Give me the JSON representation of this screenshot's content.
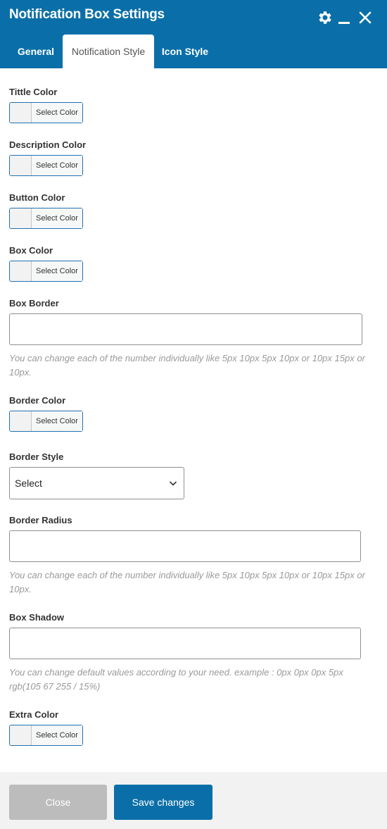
{
  "header": {
    "title": "Notification Box Settings",
    "icons": [
      "gear-icon",
      "minimize-icon",
      "close-icon"
    ],
    "accent_color": "#0a6fa8"
  },
  "tabs": [
    {
      "label": "General",
      "active": false
    },
    {
      "label": "Notification Style",
      "active": true
    },
    {
      "label": "Icon Style",
      "active": false
    }
  ],
  "form": {
    "title_color": {
      "label": "Tittle Color",
      "button": "Select Color"
    },
    "description_color": {
      "label": "Description Color",
      "button": "Select Color"
    },
    "button_color": {
      "label": "Button Color",
      "button": "Select Color"
    },
    "box_color": {
      "label": "Box Color",
      "button": "Select Color"
    },
    "box_border": {
      "label": "Box Border",
      "value": "",
      "help": "You can change each of the number individually like 5px 10px 5px 10px or 10px 15px or 10px."
    },
    "border_color": {
      "label": "Border Color",
      "button": "Select Color"
    },
    "border_style": {
      "label": "Border Style",
      "selected": "Select"
    },
    "border_radius": {
      "label": "Border Radius",
      "value": "",
      "help": "You can change each of the number individually like 5px 10px 5px 10px or 10px 15px or 10px."
    },
    "box_shadow": {
      "label": "Box Shadow",
      "value": "",
      "help": "You can change default values according to your need. example : 0px 0px 0px 5px rgb(105 67 255 / 15%)"
    },
    "extra_color": {
      "label": "Extra Color",
      "button": "Select Color"
    }
  },
  "footer": {
    "close_label": "Close",
    "save_label": "Save changes"
  }
}
